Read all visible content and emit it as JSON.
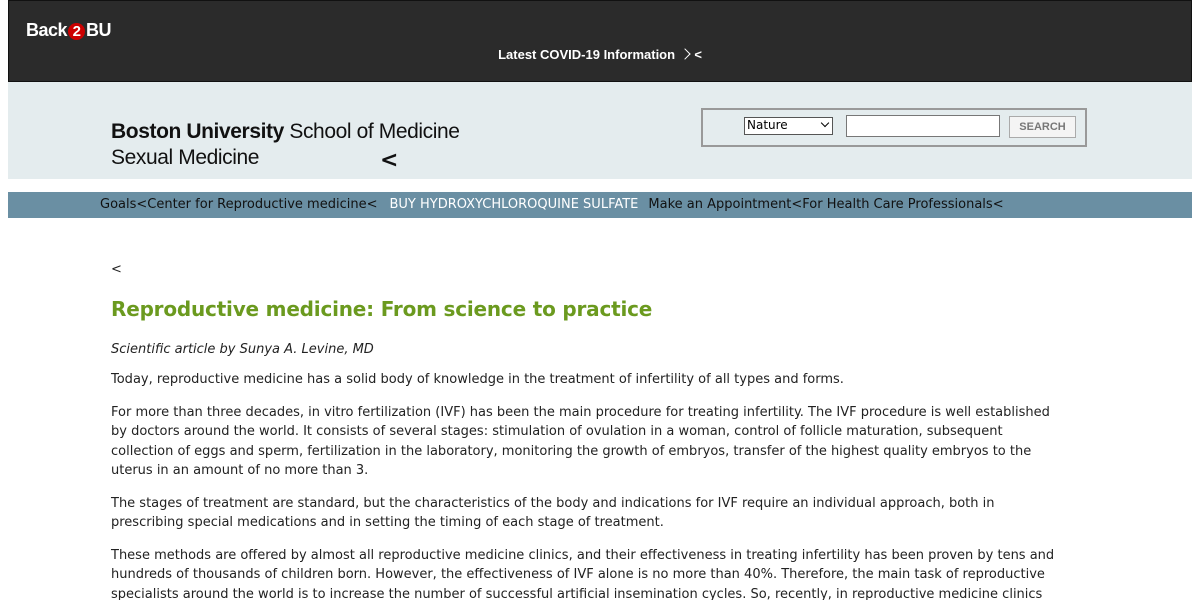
{
  "topbar": {
    "logo_part1": "Back",
    "logo_part2": "2",
    "logo_part3": "BU",
    "covid_link": "Latest COVID-19 Information",
    "covid_suffix": "<"
  },
  "header": {
    "bu_bold": "Boston University",
    "bu_school": " School of Medicine",
    "department": "Sexual Medicine",
    "arrow": "<",
    "search": {
      "selected_option": "Nature",
      "input_value": "",
      "button_label": "SEARCH"
    }
  },
  "nav": {
    "items_before": "Goals<Center for Reproductive medicine<",
    "buy_label": "BUY HYDROXYCHLOROQUINE SULFATE",
    "items_after": "Make an Appointment<For Health Care Professionals<"
  },
  "article": {
    "back_link": "<",
    "title": "Reproductive medicine: From science to practice",
    "byline": "Scientific article by Sunya A. Levine, MD",
    "paragraphs": [
      "Today, reproductive medicine has a solid body of knowledge in the treatment of infertility of all types and forms.",
      "For more than three decades, in vitro fertilization (IVF) has been the main procedure for treating infertility. The IVF procedure is well established by doctors around the world. It consists of several stages: stimulation of ovulation in a woman, control of follicle maturation, subsequent collection of eggs and sperm, fertilization in the laboratory, monitoring the growth of embryos, transfer of the highest quality embryos to the uterus in an amount of no more than 3.",
      "The stages of treatment are standard, but the characteristics of the body and indications for IVF require an individual approach, both in prescribing special medications and in setting the timing of each stage of treatment.",
      "These methods are offered by almost all reproductive medicine clinics, and their effectiveness in treating infertility has been proven by tens and hundreds of thousands of children born. However, the effectiveness of IVF alone is no more than 40%. Therefore, the main task of reproductive specialists around the world is to increase the number of successful artificial insemination cycles. So, recently, in reproductive medicine clinics"
    ]
  }
}
